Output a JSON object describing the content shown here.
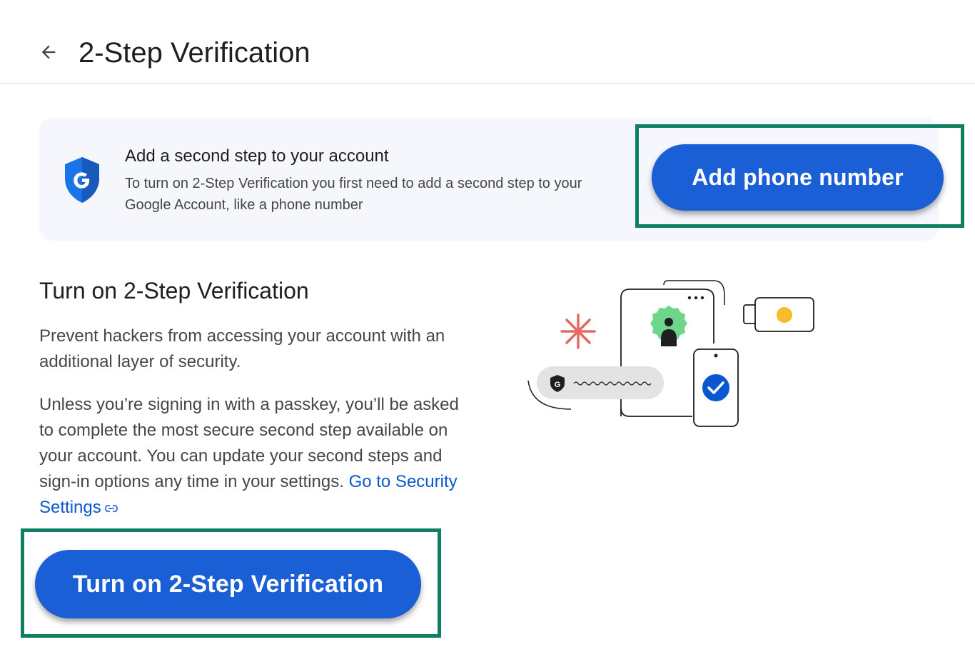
{
  "header": {
    "title": "2-Step Verification",
    "back_icon": "arrow-back-icon"
  },
  "banner": {
    "icon": "google-shield-icon",
    "title": "Add a second step to your account",
    "description": "To turn on 2-Step Verification you first need to add a second step to your Google Account, like a phone number",
    "button_label": "Add phone number"
  },
  "main": {
    "title": "Turn on 2-Step Verification",
    "paragraph1": "Prevent hackers from accessing your account with an additional layer of security.",
    "paragraph2": "Unless you’re signing in with a passkey, you’ll be asked to complete the most secure second step available on your account. You can update your second steps and sign-in options any time in your settings.",
    "link_label": "Go to Security Settings",
    "link_icon": "external-link-icon",
    "button_label": "Turn on 2-Step Verification"
  },
  "colors": {
    "primary": "#1b5fd6",
    "highlight": "#0f7f62",
    "banner_bg": "#f5f7fc",
    "link": "#0b57d0"
  }
}
